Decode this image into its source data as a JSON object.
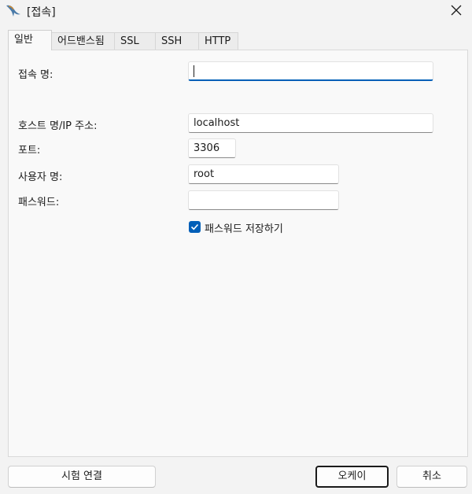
{
  "window": {
    "title": "[접속]",
    "app_icon": "mysql-dolphin-icon",
    "close_icon": "close-icon"
  },
  "tabs": [
    {
      "label": "일반",
      "active": true
    },
    {
      "label": "어드밴스됨",
      "active": false
    },
    {
      "label": "SSL",
      "active": false
    },
    {
      "label": "SSH",
      "active": false
    },
    {
      "label": "HTTP",
      "active": false
    }
  ],
  "form": {
    "connection_name": {
      "label": "접속 명:",
      "value": ""
    },
    "host": {
      "label": "호스트 명/IP 주소:",
      "value": "localhost"
    },
    "port": {
      "label": "포트:",
      "value": "3306"
    },
    "username": {
      "label": "사용자 명:",
      "value": "root"
    },
    "password": {
      "label": "패스워드:",
      "value": ""
    },
    "save_password": {
      "label": "패스워드 저장하기",
      "checked": true
    }
  },
  "buttons": {
    "test": "시험 연결",
    "ok": "오케이",
    "cancel": "취소"
  },
  "colors": {
    "accent": "#005fb8",
    "background": "#f3f3f3",
    "panel": "#f9f9f9"
  }
}
